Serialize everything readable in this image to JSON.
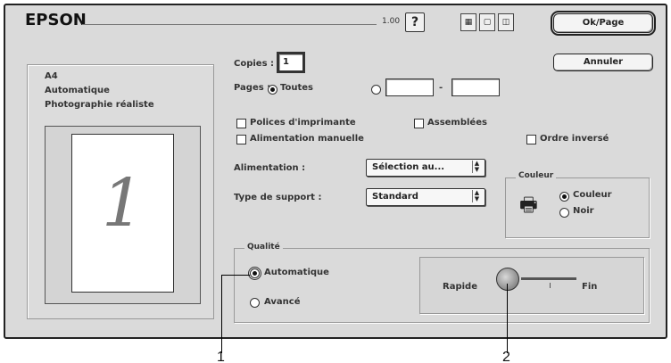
{
  "header": {
    "brand": "EPSON",
    "version": "1.00",
    "help_label": "?",
    "tool_icons": [
      "layout-icon",
      "page-icon",
      "zoom-icon"
    ]
  },
  "buttons": {
    "print": "Ok/Page",
    "cancel": "Annuler"
  },
  "summary": {
    "paper_size": "A4",
    "mode": "Automatique",
    "media": "Photographie réaliste",
    "preview_page": "1"
  },
  "copies": {
    "label": "Copies :",
    "value": "1"
  },
  "pages": {
    "label": "Pages :",
    "all_label": "Toutes",
    "from_value": "",
    "dash": "-",
    "to_value": ""
  },
  "checks": {
    "printer_fonts": "Polices d'imprimante",
    "collate": "Assemblées",
    "manual_feed": "Alimentation manuelle",
    "reverse_order": "Ordre inversé"
  },
  "feed": {
    "label": "Alimentation :",
    "value": "Sélection au..."
  },
  "media_type": {
    "label": "Type de support :",
    "value": "Standard"
  },
  "color": {
    "title": "Couleur",
    "option_color": "Couleur",
    "option_black": "Noir",
    "selected": "Couleur"
  },
  "quality": {
    "title": "Qualité",
    "option_auto": "Automatique",
    "option_advanced": "Avancé",
    "selected": "Automatique",
    "speed_label": "Rapide",
    "fine_label": "Fin",
    "slider_level": 0
  },
  "callouts": [
    "1",
    "2"
  ],
  "colors": {
    "window_bg": "#dadada",
    "border": "#222222"
  }
}
